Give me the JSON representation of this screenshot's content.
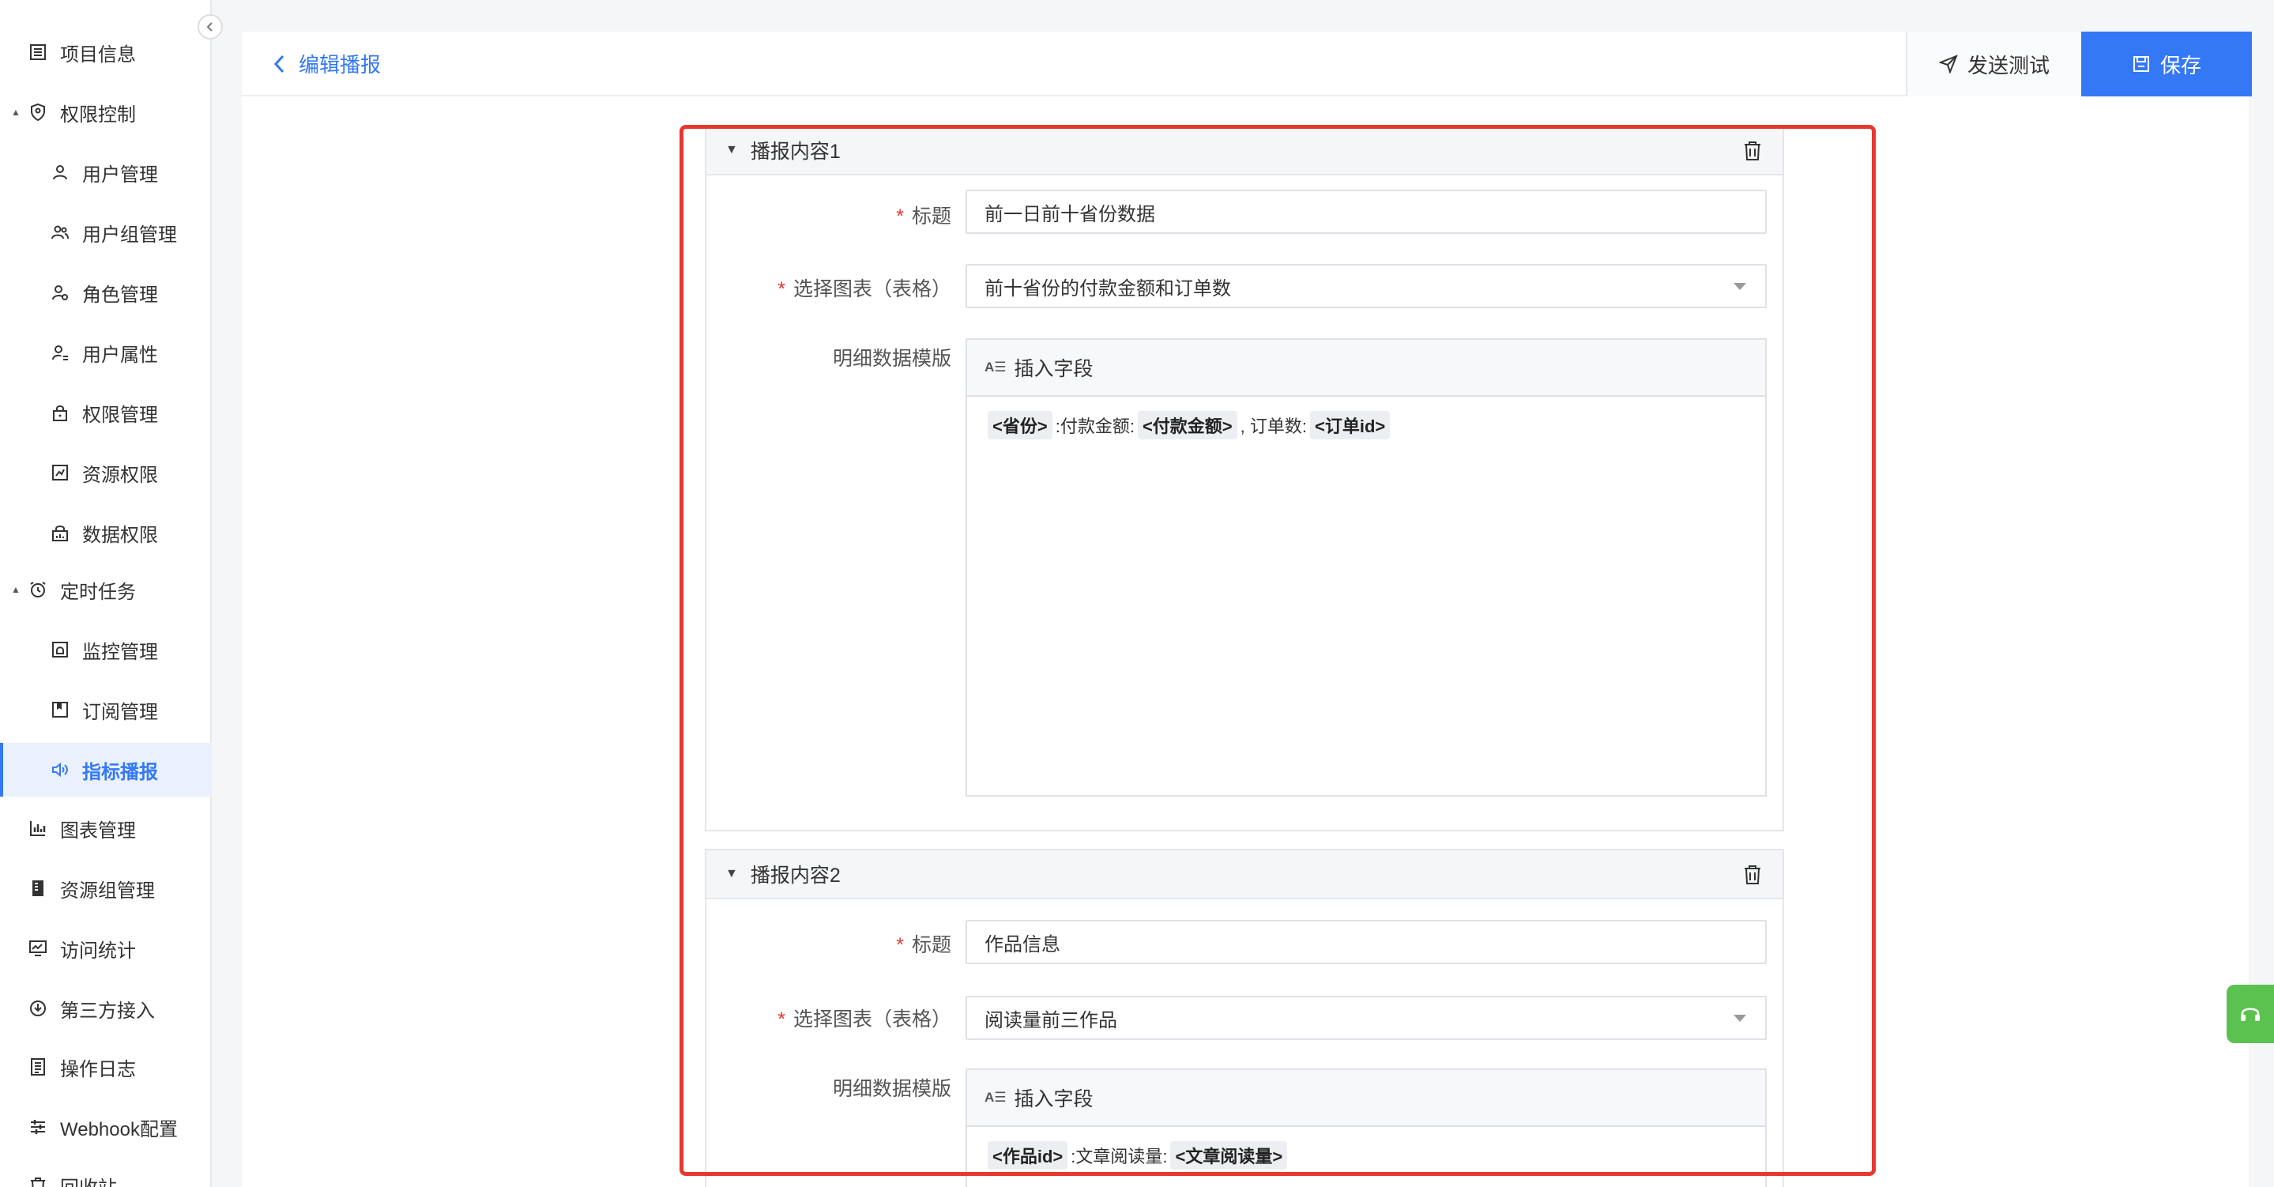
{
  "sidebar": {
    "items": [
      {
        "label": "项目信息"
      },
      {
        "label": "权限控制"
      },
      {
        "label": "用户管理"
      },
      {
        "label": "用户组管理"
      },
      {
        "label": "角色管理"
      },
      {
        "label": "用户属性"
      },
      {
        "label": "权限管理"
      },
      {
        "label": "资源权限"
      },
      {
        "label": "数据权限"
      },
      {
        "label": "定时任务"
      },
      {
        "label": "监控管理"
      },
      {
        "label": "订阅管理"
      },
      {
        "label": "指标播报"
      },
      {
        "label": "图表管理"
      },
      {
        "label": "资源组管理"
      },
      {
        "label": "访问统计"
      },
      {
        "label": "第三方接入"
      },
      {
        "label": "操作日志"
      },
      {
        "label": "Webhook配置"
      },
      {
        "label": "回收站"
      }
    ],
    "active_item": "指标播报"
  },
  "header": {
    "back_label": "编辑播报",
    "send_test_label": "发送测试",
    "save_label": "保存"
  },
  "cards": [
    {
      "title": "播报内容1",
      "title_label": "标题",
      "title_value": "前一日前十省份数据",
      "chart_label": "选择图表（表格）",
      "chart_value": "前十省份的付款金额和订单数",
      "template_label": "明细数据模版",
      "insert_field_label": "插入字段",
      "template": {
        "t1": "<省份>",
        "s1": ":付款金额:",
        "t2": "<付款金额>",
        "s2": ", 订单数:",
        "t3": "<订单id>"
      }
    },
    {
      "title": "播报内容2",
      "title_label": "标题",
      "title_value": "作品信息",
      "chart_label": "选择图表（表格）",
      "chart_value": "阅读量前三作品",
      "template_label": "明细数据模版",
      "insert_field_label": "插入字段",
      "template": {
        "t1": "<作品id>",
        "s1": ":文章阅读量:",
        "t2": "<文章阅读量>"
      }
    }
  ],
  "colors": {
    "primary": "#3478f6",
    "required": "#e8382f",
    "highlight_border": "#e8382f",
    "support_button": "#5cc24f"
  }
}
